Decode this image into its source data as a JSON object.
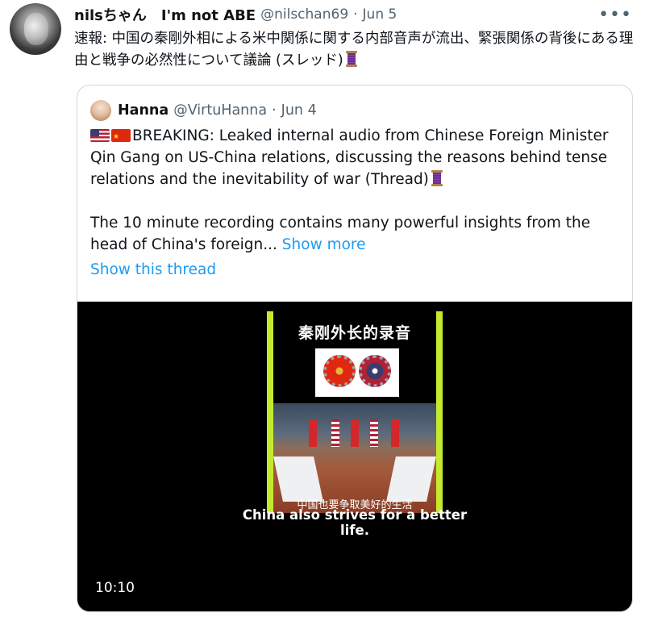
{
  "tweet": {
    "display_name": "nilsちゃん　I'm not ABE",
    "handle": "@nilschan69",
    "separator": "·",
    "date": "Jun 5",
    "more_icon": "more-horizontal-icon",
    "text": "速報: 中国の秦剛外相による米中関係に関する内部音声が流出、緊張関係の背後にある理由と戦争の必然性について議論 (スレッド)"
  },
  "quoted_tweet": {
    "display_name": "Hanna",
    "handle": "@VirtuHanna",
    "separator": "·",
    "date": "Jun 4",
    "text_p1": "BREAKING: Leaked internal audio from Chinese Foreign Minister Qin Gang on US-China relations, discussing the reasons behind tense relations and the inevitability of war (Thread)",
    "text_p2": "The 10 minute recording contains many powerful insights from the head of China's foreign...",
    "show_more_label": "Show more",
    "show_thread_label": "Show this thread"
  },
  "video": {
    "poster_title": "秦刚外长的录音",
    "poster_caption_cn": "中国也要争取美好的生活",
    "subtitle": "China also strives for a better life.",
    "duration": "10:10"
  },
  "colors": {
    "link": "#1d9bf0",
    "secondary_text": "#536471",
    "border": "#cfd9de",
    "poster_frame": "#c5ea2c"
  }
}
